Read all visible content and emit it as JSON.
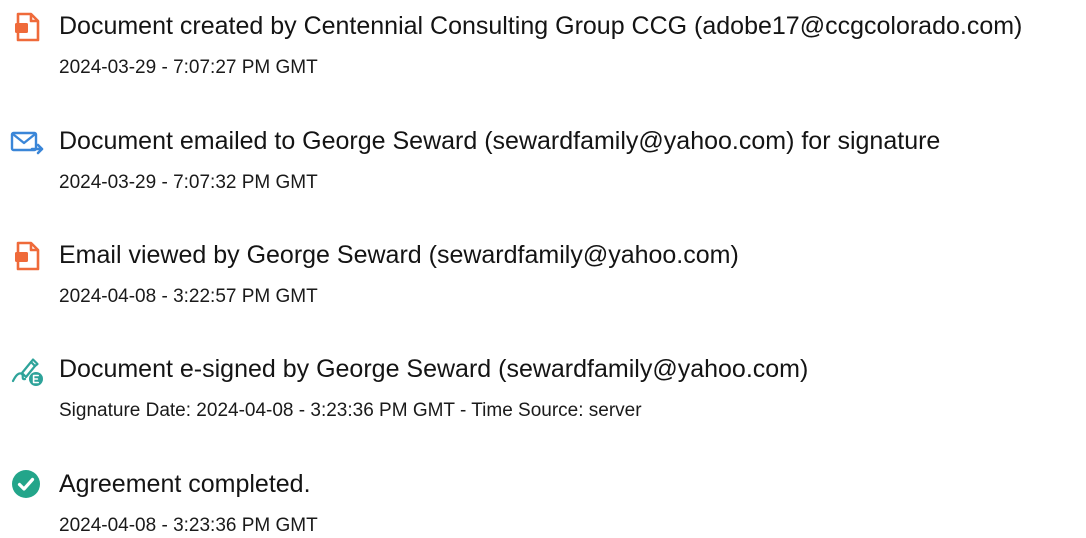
{
  "colors": {
    "doc_orange": "#ef6a3a",
    "email_blue": "#3a86d8",
    "sign_teal": "#2ea39a",
    "complete_green": "#23a58a"
  },
  "events": [
    {
      "icon": "document-icon",
      "title": "Document created by Centennial Consulting Group CCG (adobe17@ccgcolorado.com)",
      "detail": "2024-03-29 - 7:07:27 PM GMT"
    },
    {
      "icon": "email-sent-icon",
      "title": "Document emailed to George Seward (sewardfamily@yahoo.com) for signature",
      "detail": "2024-03-29 - 7:07:32 PM GMT"
    },
    {
      "icon": "document-icon",
      "title": "Email viewed by George Seward (sewardfamily@yahoo.com)",
      "detail": "2024-04-08 - 3:22:57 PM GMT"
    },
    {
      "icon": "esign-icon",
      "title": "Document e-signed by George Seward (sewardfamily@yahoo.com)",
      "detail": "Signature Date: 2024-04-08 - 3:23:36 PM GMT - Time Source: server"
    },
    {
      "icon": "checkmark-circle-icon",
      "title": "Agreement completed.",
      "detail": "2024-04-08 - 3:23:36 PM GMT"
    }
  ]
}
